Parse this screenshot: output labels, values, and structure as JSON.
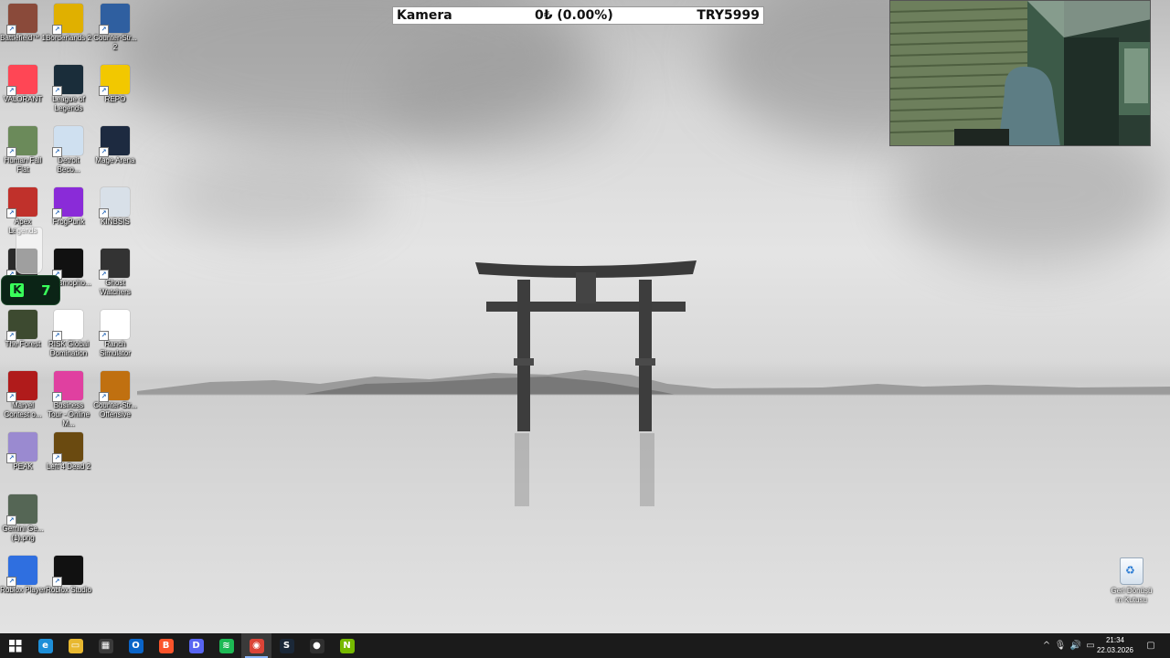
{
  "overlay": {
    "label": "Kamera",
    "value": "0₺ (0.00%)",
    "currency": "TRY5999"
  },
  "widget": {
    "letter": "K",
    "number": "7"
  },
  "desktop_icons": [
    {
      "label": "Battlefield™ 1",
      "icon": "battlefield-icon",
      "color": "#8a4a3a"
    },
    {
      "label": "Borderlands 2",
      "icon": "borderlands-icon",
      "color": "#e0b000"
    },
    {
      "label": "Counter-Str... 2",
      "icon": "counter-strike-2-icon",
      "color": "#2f5fa0"
    },
    {
      "label": "VALORANT",
      "icon": "valorant-icon",
      "color": "#ff4655"
    },
    {
      "label": "League of Legends",
      "icon": "league-icon",
      "color": "#1a2d3a"
    },
    {
      "label": "REPO",
      "icon": "repo-icon",
      "color": "#f2c800"
    },
    {
      "label": "Human Fall Flat",
      "icon": "human-fall-flat-icon",
      "color": "#6b8a5a"
    },
    {
      "label": "Detroit Beco...",
      "icon": "detroit-icon",
      "color": "#cfe0f0"
    },
    {
      "label": "Mage Arena",
      "icon": "mage-arena-icon",
      "color": "#1d2a40"
    },
    {
      "label": "Apex Legends",
      "icon": "apex-icon",
      "color": "#c0312b"
    },
    {
      "label": "FrogPunk",
      "icon": "frogpunk-icon",
      "color": "#8a2bd8"
    },
    {
      "label": "KINBSIS",
      "icon": "kinbsis-icon",
      "color": "#d8e0e8"
    },
    {
      "label": "",
      "icon": "game-icon",
      "color": "#2a2a2a"
    },
    {
      "label": "Phasmopho...",
      "icon": "phasmophobia-icon",
      "color": "#111111"
    },
    {
      "label": "Ghost Watchers",
      "icon": "ghost-watchers-icon",
      "color": "#333333"
    },
    {
      "label": "The Forest",
      "icon": "the-forest-icon",
      "color": "#3d4a30"
    },
    {
      "label": "RISK Global Domination",
      "icon": "risk-icon",
      "color": "#ffffff"
    },
    {
      "label": "Ranch Simulator",
      "icon": "ranch-simulator-icon",
      "color": "#ffffff"
    },
    {
      "label": "Marvel Contest o...",
      "icon": "marvel-icon",
      "color": "#b01b1b"
    },
    {
      "label": "Business Tour - Online M...",
      "icon": "business-tour-icon",
      "color": "#e040a0"
    },
    {
      "label": "Counter-Str... Offensive",
      "icon": "cs-go-icon",
      "color": "#c07010"
    },
    {
      "label": "PEAK",
      "icon": "peak-icon",
      "color": "#9a8ad0"
    },
    {
      "label": "Left 4 Dead 2",
      "icon": "left4dead2-icon",
      "color": "#6a4a10"
    },
    {
      "label": "Gemini Ge... (1).png",
      "icon": "image-file-icon",
      "color": "#556655"
    },
    {
      "label": "Roblox Player",
      "icon": "roblox-player-icon",
      "color": "#2f6fe0"
    },
    {
      "label": "Roblox Studio",
      "icon": "roblox-studio-icon",
      "color": "#111111"
    }
  ],
  "recycle_bin": {
    "label": "Geri Dönüşü m Kutusu"
  },
  "taskbar": {
    "apps": [
      {
        "icon": "edge-icon",
        "glyph": "e",
        "color": "#1e8fd8"
      },
      {
        "icon": "file-explorer-icon",
        "glyph": "▭",
        "color": "#e8b830"
      },
      {
        "icon": "microsoft-store-icon",
        "glyph": "▦",
        "color": "#3a3a3a"
      },
      {
        "icon": "outlook-icon",
        "glyph": "O",
        "color": "#0a64c8"
      },
      {
        "icon": "brave-icon",
        "glyph": "B",
        "color": "#fb542b"
      },
      {
        "icon": "discord-icon",
        "glyph": "D",
        "color": "#5865f2"
      },
      {
        "icon": "spotify-icon",
        "glyph": "≋",
        "color": "#1db954"
      },
      {
        "icon": "chrome-icon",
        "glyph": "◉",
        "color": "#db4437"
      },
      {
        "icon": "steam-icon",
        "glyph": "S",
        "color": "#1b2838"
      },
      {
        "icon": "obs-icon",
        "glyph": "●",
        "color": "#303030"
      },
      {
        "icon": "nvidia-icon",
        "glyph": "N",
        "color": "#76b900"
      }
    ],
    "time": "21:34",
    "date": "22.03.2026"
  }
}
